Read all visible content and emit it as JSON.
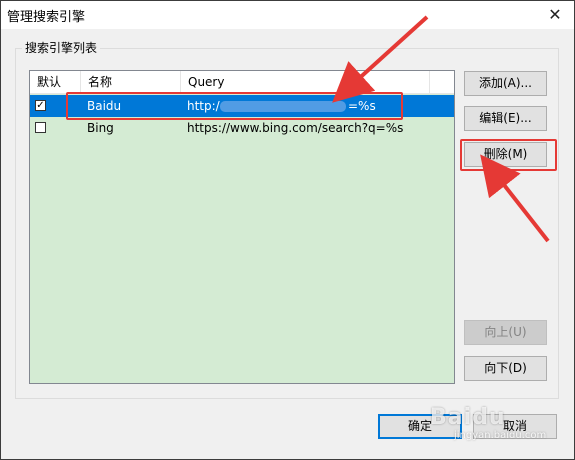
{
  "window": {
    "title": "管理搜索引擎",
    "close_glyph": "✕"
  },
  "group": {
    "label": "搜索引擎列表"
  },
  "list": {
    "columns": [
      "默认",
      "名称",
      "Query"
    ],
    "rows": [
      {
        "default": true,
        "name": "Baidu",
        "query_prefix": "http:/",
        "query_suffix": "=%s",
        "selected": true
      },
      {
        "default": false,
        "name": "Bing",
        "query": "https://www.bing.com/search?q=%s",
        "selected": false
      }
    ]
  },
  "buttons": {
    "add": "添加(A)...",
    "edit": "编辑(E)...",
    "delete": "删除(M)",
    "up": "向上(U)",
    "down": "向下(D)",
    "ok": "确定",
    "cancel": "取消"
  },
  "watermark": {
    "text": "Baidu",
    "sub": "jingyan.baidu.com"
  },
  "colors": {
    "annotation": "#e53935",
    "selection": "#0078d7",
    "list_bg": "#d4ebd3"
  }
}
